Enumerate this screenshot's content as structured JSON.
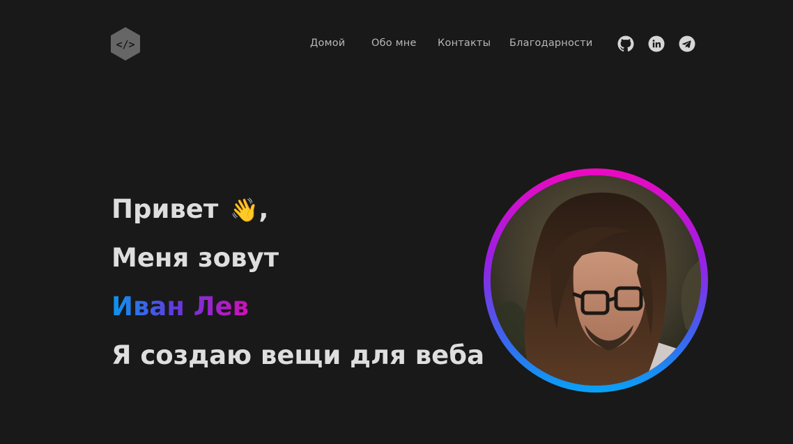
{
  "nav": {
    "logo_icon": "code-hexagon-icon",
    "links": [
      "Домой",
      "Обо мне",
      "Контакты",
      "Благодарности"
    ],
    "social": [
      "github-icon",
      "linkedin-icon",
      "telegram-icon"
    ]
  },
  "hero": {
    "greeting": "Привет",
    "wave_emoji": "👋",
    "greeting_suffix": ",",
    "intro": "Меня зовут",
    "name": "Иван Лев",
    "tagline": "Я создаю вещи для веба"
  },
  "colors": {
    "background": "#191919",
    "gradient_start": "#0a97f0",
    "gradient_end": "#d10fb6"
  }
}
